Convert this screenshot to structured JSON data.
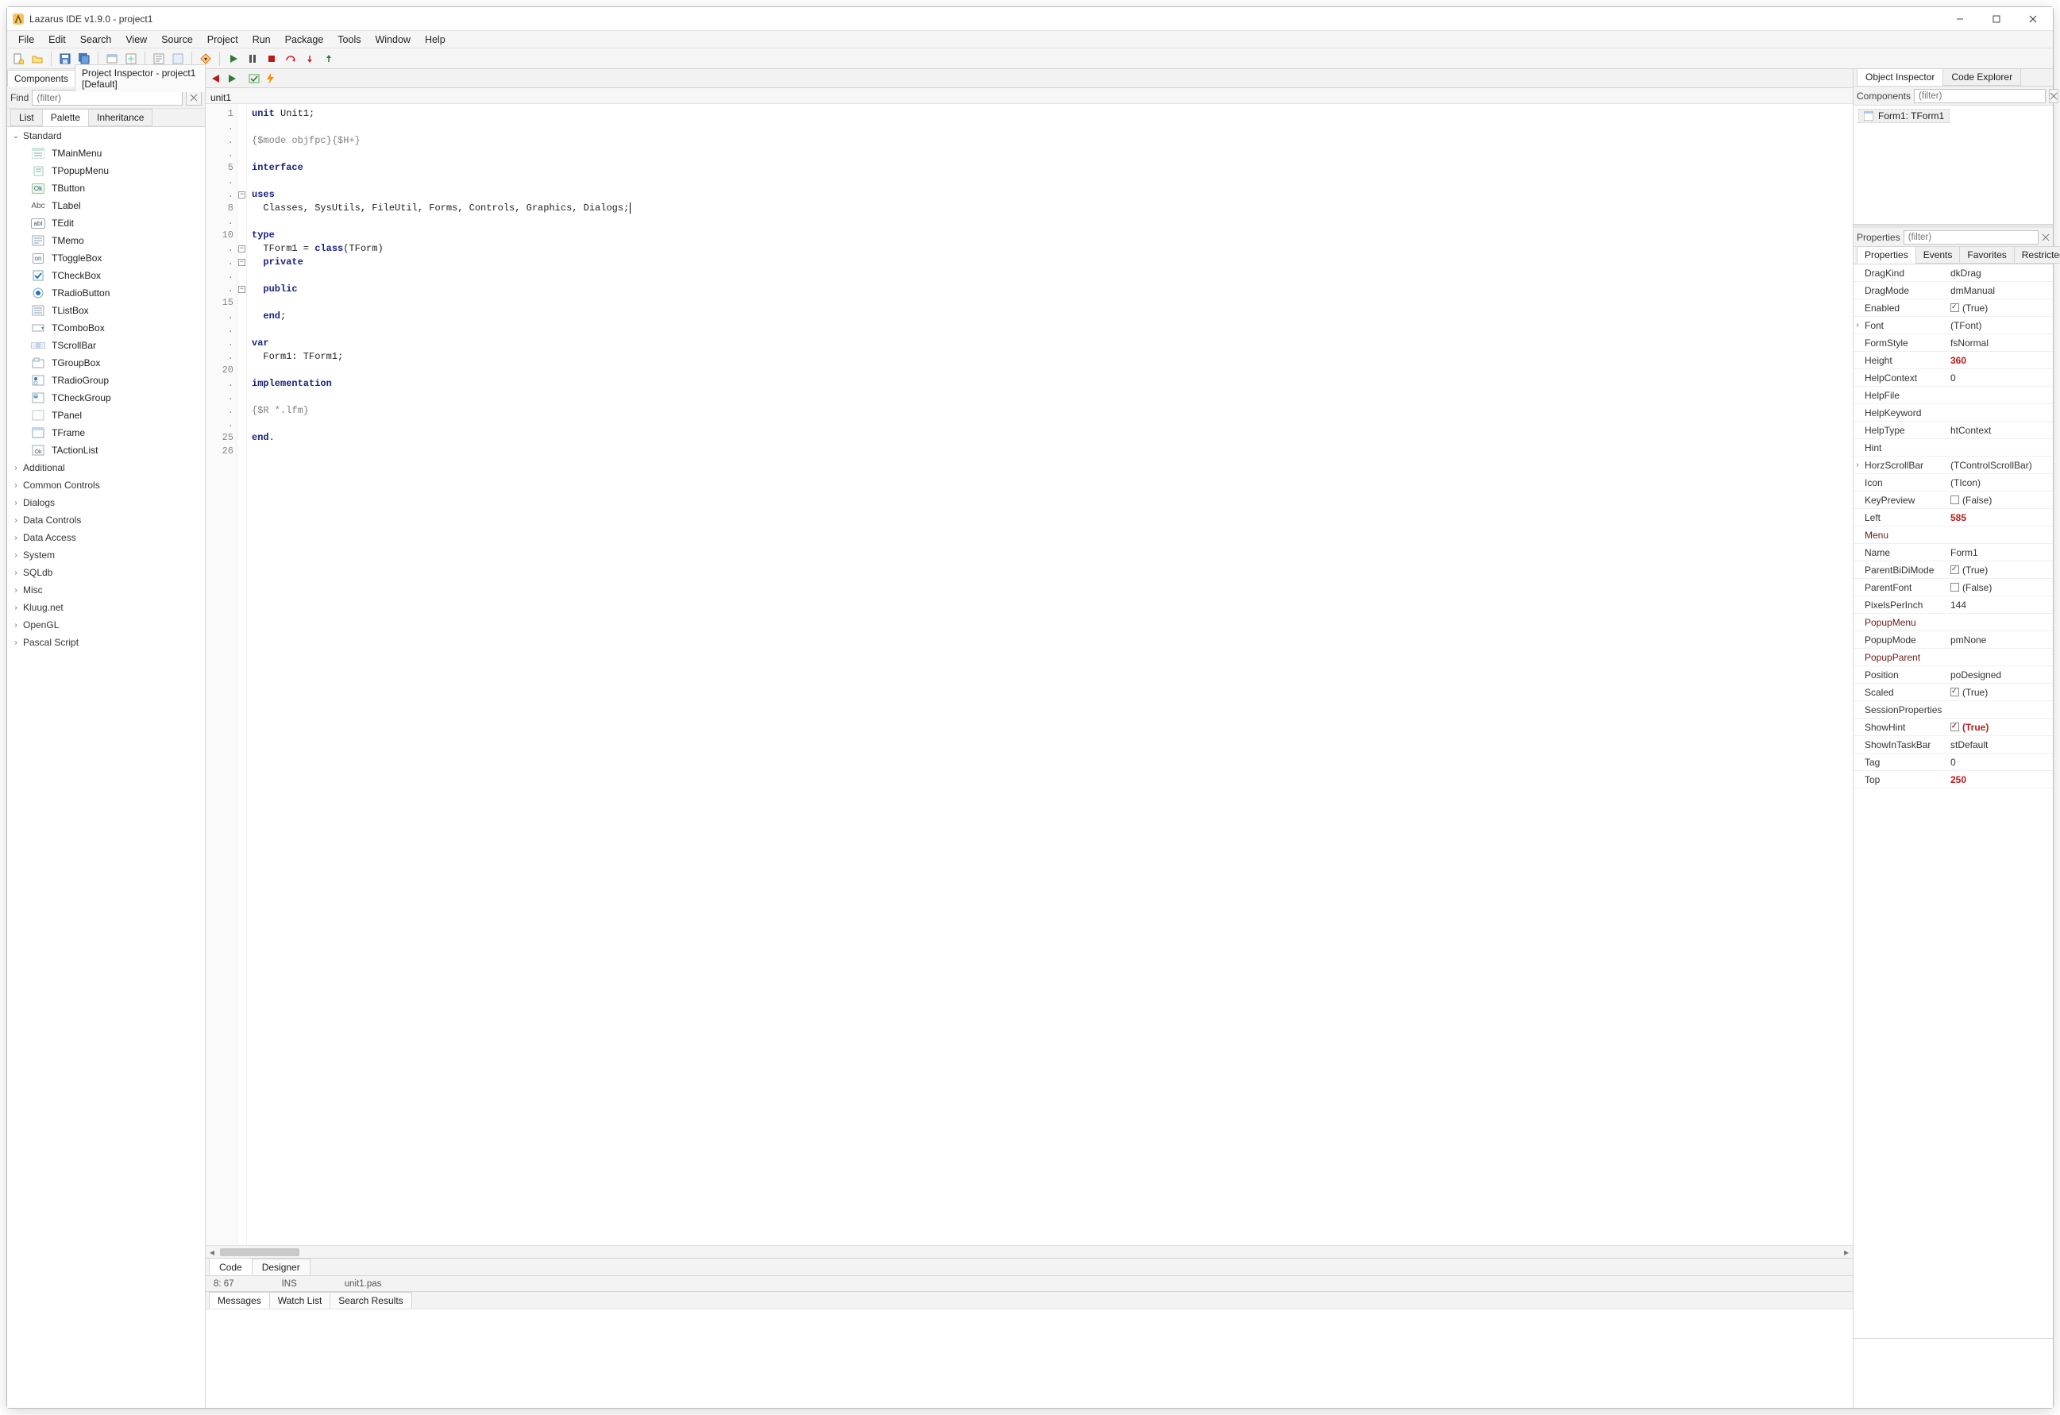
{
  "window": {
    "title": "Lazarus IDE v1.9.0 - project1"
  },
  "menu": [
    "File",
    "Edit",
    "Search",
    "View",
    "Source",
    "Project",
    "Run",
    "Package",
    "Tools",
    "Window",
    "Help"
  ],
  "left": {
    "topTabs": [
      "Components",
      "Project Inspector - project1 [Default]"
    ],
    "activeTopTab": 0,
    "find_label": "Find",
    "find_placeholder": "(filter)",
    "subTabs": [
      "List",
      "Palette",
      "Inheritance"
    ],
    "activeSubTab": 1,
    "palette": {
      "expandedGroup": "Standard",
      "items": [
        {
          "icon": "menu",
          "label": "TMainMenu"
        },
        {
          "icon": "popup",
          "label": "TPopupMenu"
        },
        {
          "icon": "Ok",
          "label": "TButton"
        },
        {
          "icon": "Abc",
          "label": "TLabel"
        },
        {
          "icon": "abI",
          "label": "TEdit"
        },
        {
          "icon": "memo",
          "label": "TMemo"
        },
        {
          "icon": "on",
          "label": "TToggleBox"
        },
        {
          "icon": "check",
          "label": "TCheckBox"
        },
        {
          "icon": "radio",
          "label": "TRadioButton"
        },
        {
          "icon": "list",
          "label": "TListBox"
        },
        {
          "icon": "combo",
          "label": "TComboBox"
        },
        {
          "icon": "scroll",
          "label": "TScrollBar"
        },
        {
          "icon": "group",
          "label": "TGroupBox"
        },
        {
          "icon": "rgroup",
          "label": "TRadioGroup"
        },
        {
          "icon": "cgroup",
          "label": "TCheckGroup"
        },
        {
          "icon": "panel",
          "label": "TPanel"
        },
        {
          "icon": "frame",
          "label": "TFrame"
        },
        {
          "icon": "action",
          "label": "TActionList"
        }
      ],
      "collapsedGroups": [
        "Additional",
        "Common Controls",
        "Dialogs",
        "Data Controls",
        "Data Access",
        "System",
        "SQLdb",
        "Misc",
        "Kluug.net",
        "OpenGL",
        "Pascal Script"
      ]
    }
  },
  "center": {
    "tabs": [
      "unit1"
    ],
    "codeLines": [
      {
        "n": "1",
        "t": "<kw>unit</kw> Unit1;"
      },
      {
        "n": ".",
        "t": ""
      },
      {
        "n": ".",
        "t": "<cm>{$mode objfpc}{$H+}</cm>"
      },
      {
        "n": ".",
        "t": ""
      },
      {
        "n": "5",
        "t": "<kw>interface</kw>"
      },
      {
        "n": ".",
        "t": ""
      },
      {
        "n": ".",
        "t": "<kw>uses</kw>",
        "fold": "-"
      },
      {
        "n": "8",
        "t": "  Classes, SysUtils, FileUtil, Forms, Controls, Graphics, Dialogs;<blink>|</blink>"
      },
      {
        "n": ".",
        "t": ""
      },
      {
        "n": "10",
        "t": "<kw>type</kw>"
      },
      {
        "n": ".",
        "t": "  TForm1 = <kw>class</kw>(TForm)",
        "fold": "-"
      },
      {
        "n": ".",
        "t": "  <kw>private</kw>",
        "fold": "-"
      },
      {
        "n": ".",
        "t": ""
      },
      {
        "n": ".",
        "t": "  <kw>public</kw>",
        "fold": "-"
      },
      {
        "n": "15",
        "t": ""
      },
      {
        "n": ".",
        "t": "  <kw>end</kw>;"
      },
      {
        "n": ".",
        "t": ""
      },
      {
        "n": ".",
        "t": "<kw>var</kw>"
      },
      {
        "n": ".",
        "t": "  Form1: TForm1;"
      },
      {
        "n": "20",
        "t": ""
      },
      {
        "n": ".",
        "t": "<kw>implementation</kw>"
      },
      {
        "n": ".",
        "t": ""
      },
      {
        "n": ".",
        "t": "<cm>{$R *.lfm}</cm>"
      },
      {
        "n": ".",
        "t": ""
      },
      {
        "n": "25",
        "t": "<kw>end</kw>."
      },
      {
        "n": "26",
        "t": ""
      }
    ],
    "bottomTabs": [
      "Code",
      "Designer"
    ],
    "activeBottomTab": 0,
    "status": {
      "pos": "8: 67",
      "mode": "INS",
      "file": "unit1.pas"
    }
  },
  "messages": {
    "tabs": [
      "Messages",
      "Watch List",
      "Search Results"
    ],
    "active": 0
  },
  "right": {
    "topTabs": [
      "Object Inspector",
      "Code Explorer"
    ],
    "activeTopTab": 0,
    "components_label": "Components",
    "components_placeholder": "(filter)",
    "treeNode": "Form1: TForm1",
    "props_label": "Properties",
    "props_placeholder": "(filter)",
    "propTabs": [
      "Properties",
      "Events",
      "Favorites",
      "Restricted"
    ],
    "activePropTab": 0,
    "properties": [
      {
        "k": "DragKind",
        "v": "dkDrag"
      },
      {
        "k": "DragMode",
        "v": "dmManual"
      },
      {
        "k": "Enabled",
        "v": "(True)",
        "cb": true
      },
      {
        "k": "Font",
        "v": "(TFont)",
        "expandable": true
      },
      {
        "k": "FormStyle",
        "v": "fsNormal"
      },
      {
        "k": "Height",
        "v": "360",
        "changed": true
      },
      {
        "k": "HelpContext",
        "v": "0"
      },
      {
        "k": "HelpFile",
        "v": ""
      },
      {
        "k": "HelpKeyword",
        "v": ""
      },
      {
        "k": "HelpType",
        "v": "htContext"
      },
      {
        "k": "Hint",
        "v": ""
      },
      {
        "k": "HorzScrollBar",
        "v": "(TControlScrollBar)",
        "expandable": true
      },
      {
        "k": "Icon",
        "v": "(TIcon)"
      },
      {
        "k": "KeyPreview",
        "v": "(False)",
        "cb": false
      },
      {
        "k": "Left",
        "v": "585",
        "changed": true
      },
      {
        "k": "Menu",
        "v": "",
        "link": true
      },
      {
        "k": "Name",
        "v": "Form1"
      },
      {
        "k": "ParentBiDiMode",
        "v": "(True)",
        "cb": true
      },
      {
        "k": "ParentFont",
        "v": "(False)",
        "cb": false
      },
      {
        "k": "PixelsPerInch",
        "v": "144"
      },
      {
        "k": "PopupMenu",
        "v": "",
        "link": true
      },
      {
        "k": "PopupMode",
        "v": "pmNone"
      },
      {
        "k": "PopupParent",
        "v": "",
        "link": true
      },
      {
        "k": "Position",
        "v": "poDesigned"
      },
      {
        "k": "Scaled",
        "v": "(True)",
        "cb": true
      },
      {
        "k": "SessionProperties",
        "v": ""
      },
      {
        "k": "ShowHint",
        "v": "(True)",
        "cb": true,
        "changed": true
      },
      {
        "k": "ShowInTaskBar",
        "v": "stDefault"
      },
      {
        "k": "Tag",
        "v": "0"
      },
      {
        "k": "Top",
        "v": "250",
        "changed": true
      }
    ]
  }
}
